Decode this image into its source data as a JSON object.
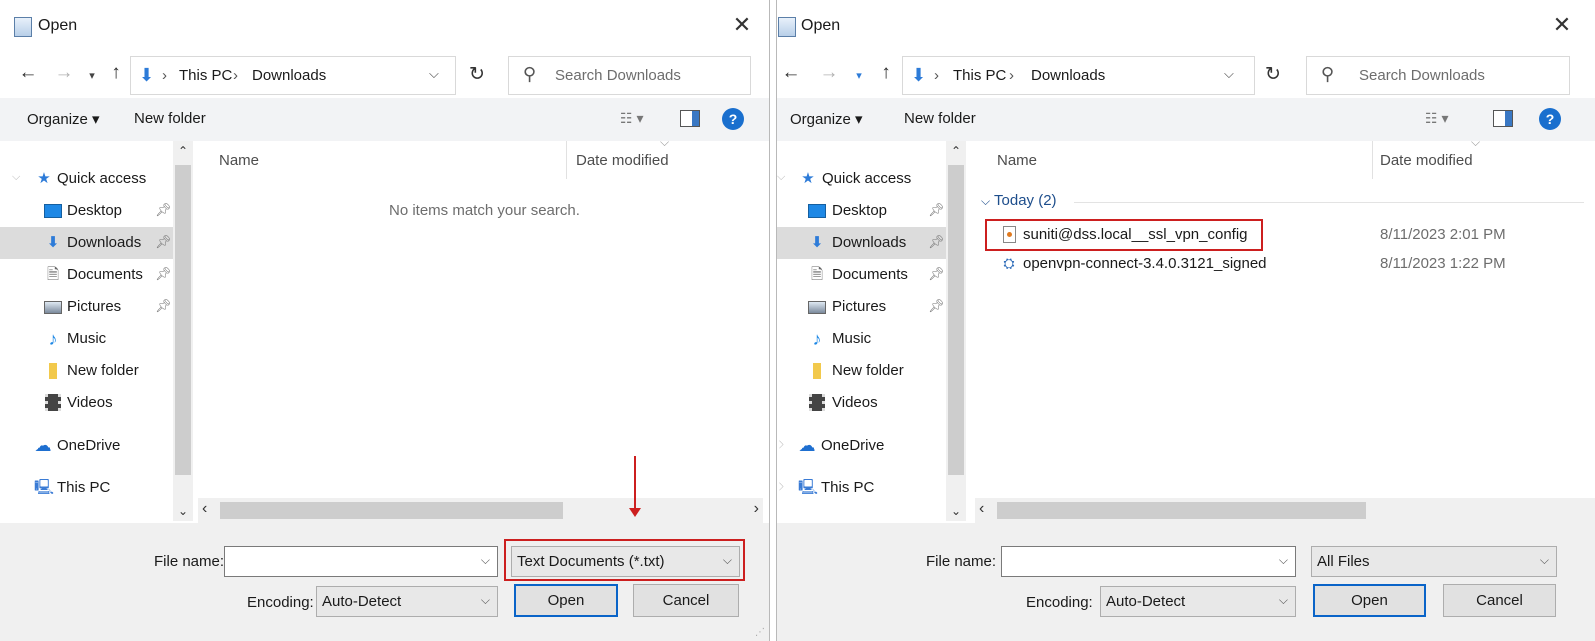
{
  "left_dialog": {
    "title": "Open",
    "breadcrumb": [
      "This PC",
      "Downloads"
    ],
    "search_placeholder": "Search Downloads",
    "toolbar": {
      "organize": "Organize ▾",
      "new_folder": "New folder"
    },
    "sidebar": {
      "quick_access": "Quick access",
      "items": [
        {
          "label": "Desktop",
          "icon": "desktop-icon",
          "pinned": true
        },
        {
          "label": "Downloads",
          "icon": "downloads-icon",
          "pinned": true,
          "selected": true
        },
        {
          "label": "Documents",
          "icon": "documents-icon",
          "pinned": true
        },
        {
          "label": "Pictures",
          "icon": "pictures-icon",
          "pinned": true
        },
        {
          "label": "Music",
          "icon": "music-icon",
          "pinned": false
        },
        {
          "label": "New folder",
          "icon": "folder-icon",
          "pinned": false
        },
        {
          "label": "Videos",
          "icon": "videos-icon",
          "pinned": false
        }
      ],
      "onedrive": "OneDrive",
      "this_pc": "This PC"
    },
    "columns": {
      "name": "Name",
      "date": "Date modified"
    },
    "empty_message": "No items match your search.",
    "bottom": {
      "file_name_label": "File name:",
      "file_name_value": "",
      "file_type": "Text Documents (*.txt)",
      "encoding_label": "Encoding:",
      "encoding_value": "Auto-Detect",
      "open": "Open",
      "cancel": "Cancel"
    }
  },
  "right_dialog": {
    "title": "Open",
    "breadcrumb": [
      "This PC",
      "Downloads"
    ],
    "search_placeholder": "Search Downloads",
    "toolbar": {
      "organize": "Organize ▾",
      "new_folder": "New folder"
    },
    "sidebar": {
      "quick_access": "Quick access",
      "items": [
        {
          "label": "Desktop",
          "icon": "desktop-icon",
          "pinned": true
        },
        {
          "label": "Downloads",
          "icon": "downloads-icon",
          "pinned": true,
          "selected": true
        },
        {
          "label": "Documents",
          "icon": "documents-icon",
          "pinned": true
        },
        {
          "label": "Pictures",
          "icon": "pictures-icon",
          "pinned": true
        },
        {
          "label": "Music",
          "icon": "music-icon",
          "pinned": false
        },
        {
          "label": "New folder",
          "icon": "folder-icon",
          "pinned": false
        },
        {
          "label": "Videos",
          "icon": "videos-icon",
          "pinned": false
        }
      ],
      "onedrive": "OneDrive",
      "this_pc": "This PC"
    },
    "columns": {
      "name": "Name",
      "date": "Date modified"
    },
    "group_header": "Today (2)",
    "files": [
      {
        "name": "suniti@dss.local__ssl_vpn_config",
        "date": "8/11/2023 2:01 PM",
        "icon": "config-file-icon"
      },
      {
        "name": "openvpn-connect-3.4.0.3121_signed",
        "date": "8/11/2023 1:22 PM",
        "icon": "installer-icon"
      }
    ],
    "bottom": {
      "file_name_label": "File name:",
      "file_name_value": "",
      "file_type": "All Files",
      "encoding_label": "Encoding:",
      "encoding_value": "Auto-Detect",
      "open": "Open",
      "cancel": "Cancel"
    }
  },
  "colors": {
    "highlight": "#cc1f1f",
    "accent": "#0a64c8",
    "selected_bg": "#dcdcdc"
  }
}
